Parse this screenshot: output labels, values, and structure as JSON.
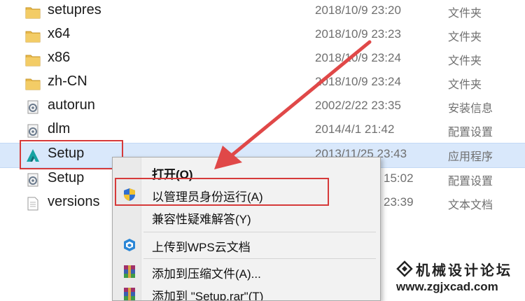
{
  "files": [
    {
      "name": "setupres",
      "date": "2018/10/9 23:20",
      "type": "文件夹",
      "icon": "folder-icon"
    },
    {
      "name": "x64",
      "date": "2018/10/9 23:23",
      "type": "文件夹",
      "icon": "folder-icon"
    },
    {
      "name": "x86",
      "date": "2018/10/9 23:24",
      "type": "文件夹",
      "icon": "folder-icon"
    },
    {
      "name": "zh-CN",
      "date": "2018/10/9 23:24",
      "type": "文件夹",
      "icon": "folder-icon"
    },
    {
      "name": "autorun",
      "date": "2002/2/22 23:35",
      "type": "安装信息",
      "icon": "settings-file-icon"
    },
    {
      "name": "dlm",
      "date": "2014/4/1 21:42",
      "type": "配置设置",
      "icon": "settings-file-icon"
    },
    {
      "name": "Setup",
      "date": "2013/11/25 23:43",
      "type": "应用程序",
      "icon": "autodesk-app-icon"
    },
    {
      "name": "Setup",
      "date": "15:02",
      "type": "配置设置",
      "icon": "settings-file-icon"
    },
    {
      "name": "versions",
      "date": "23:39",
      "type": "文本文档",
      "icon": "text-file-icon"
    }
  ],
  "context_menu": {
    "items": [
      {
        "label": "打开(O)",
        "bold": true
      },
      {
        "label": "以管理员身份运行(A)",
        "icon": "uac-shield-icon"
      },
      {
        "label": "兼容性疑难解答(Y)"
      },
      {
        "label": "上传到WPS云文档",
        "icon": "wps-cloud-icon"
      },
      {
        "label": "添加到压缩文件(A)...",
        "icon": "winrar-icon"
      },
      {
        "label": "添加到 \"Setup.rar\"(T)",
        "icon": "winrar-icon"
      }
    ]
  },
  "watermark": {
    "title": "机械设计论坛",
    "url": "www.zgjxcad.com"
  },
  "colors": {
    "highlight_red": "#d63a3a",
    "selection_blue": "#d9e8fb"
  }
}
